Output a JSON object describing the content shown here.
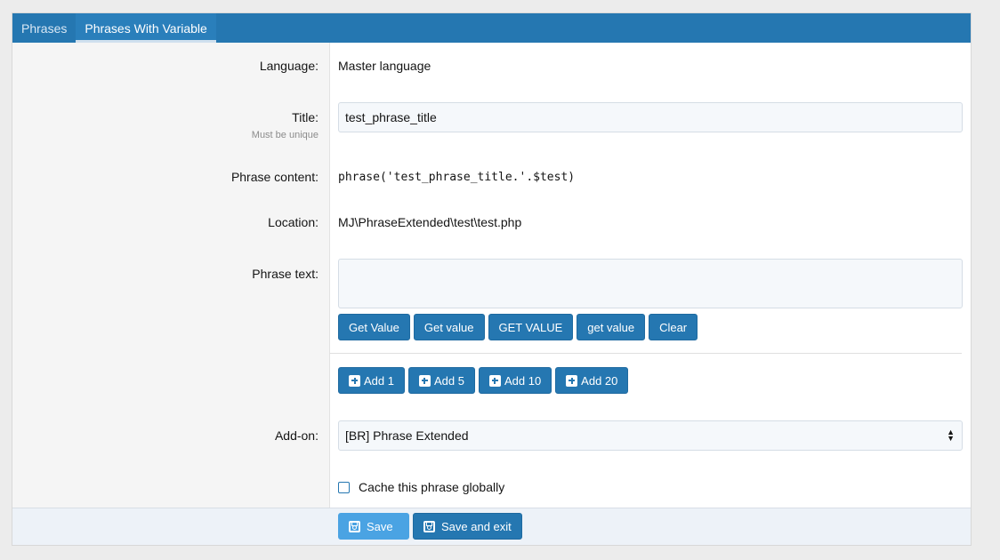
{
  "tabs": [
    {
      "label": "Phrases"
    },
    {
      "label": "Phrases With Variable"
    }
  ],
  "form": {
    "language_label": "Language:",
    "language_value": "Master language",
    "title_label": "Title:",
    "title_hint": "Must be unique",
    "title_value": "test_phrase_title",
    "content_label": "Phrase content:",
    "content_value": "phrase('test_phrase_title.'.$test)",
    "location_label": "Location:",
    "location_value": "MJ\\PhraseExtended\\test\\test.php",
    "phrase_text_label": "Phrase text:",
    "phrase_text_value": "",
    "value_buttons": [
      "Get Value",
      "Get value",
      "GET VALUE",
      "get value",
      "Clear"
    ],
    "add_buttons": [
      "Add 1",
      "Add 5",
      "Add 10",
      "Add 20"
    ],
    "addon_label": "Add-on:",
    "addon_selected": "[BR] Phrase Extended",
    "cache_label": "Cache this phrase globally",
    "cache_checked": false
  },
  "footer": {
    "save_label": "Save",
    "save_exit_label": "Save and exit"
  },
  "colors": {
    "accent": "#2577b1",
    "save_button": "#4aa3e3"
  },
  "icons": [
    "plus-square-icon",
    "save-icon",
    "select-arrows-icon",
    "checkbox-icon"
  ]
}
